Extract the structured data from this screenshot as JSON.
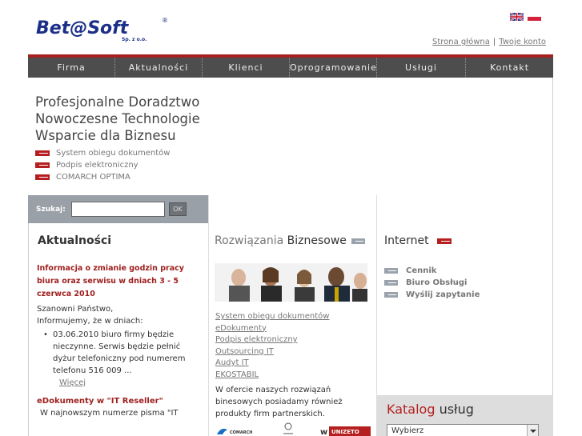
{
  "brand": {
    "logo_text": "Bet@Soft",
    "logo_sub": "Sp. z o.o.",
    "accent": "#a5201f"
  },
  "languages": [
    {
      "name": "uk-flag-icon"
    },
    {
      "name": "pl-flag-icon"
    }
  ],
  "top_links": {
    "home": "Strona główna",
    "separator": "|",
    "account": "Twoje konto"
  },
  "nav": [
    "Firma",
    "Aktualności",
    "Klienci",
    "Oprogramowanie",
    "Usługi",
    "Kontakt"
  ],
  "hero": {
    "title_lines": [
      "Profesjonalne Doradztwo",
      "Nowoczesne Technologie",
      "Wsparcie dla Biznesu"
    ],
    "links": [
      "System obiegu dokumentów",
      "Podpis elektroniczny",
      "COMARCH OPTIMA"
    ]
  },
  "search": {
    "label": "Szukaj:",
    "value": "",
    "button": "OK"
  },
  "news": {
    "title": "Aktualności",
    "item1": {
      "headline": "Informacja o zmianie godzin pracy biura oraz serwisu w dniach 3 - 5 czerwca 2010",
      "greeting": "Szanowni Państwo,",
      "intro": "Informujemy, że w dniach:",
      "bullet": "03.06.2010 biuro firmy będzie nieczynne. Serwis będzie pełnić dyżur telefoniczny pod numerem telefonu 516 009 ...",
      "more": "Więcej"
    },
    "item2": {
      "headline": "eDokumenty w \"IT Reseller\"",
      "text": "W najnowszym numerze pisma \"IT"
    }
  },
  "solutions": {
    "title_light": "Rozwiązania",
    "title_bold": "Biznesowe",
    "links": [
      "System obiegu dokumentów",
      "eDokumenty",
      "Podpis elektroniczny",
      "Outsourcing IT",
      "Audyt IT",
      "EKOSTABIL"
    ],
    "text": "W ofercie naszych rozwiązań binesowych posiadamy również produkty firm partnerskich.",
    "partners": [
      "COMARCH",
      "UNIZETO"
    ]
  },
  "internet": {
    "title": "Internet",
    "links": [
      "Cennik",
      "Biuro Obsługi",
      "Wyślij zapytanie"
    ]
  },
  "catalog": {
    "title_accent": "Katalog",
    "title_rest": "usług",
    "selected": "Wybierz"
  }
}
